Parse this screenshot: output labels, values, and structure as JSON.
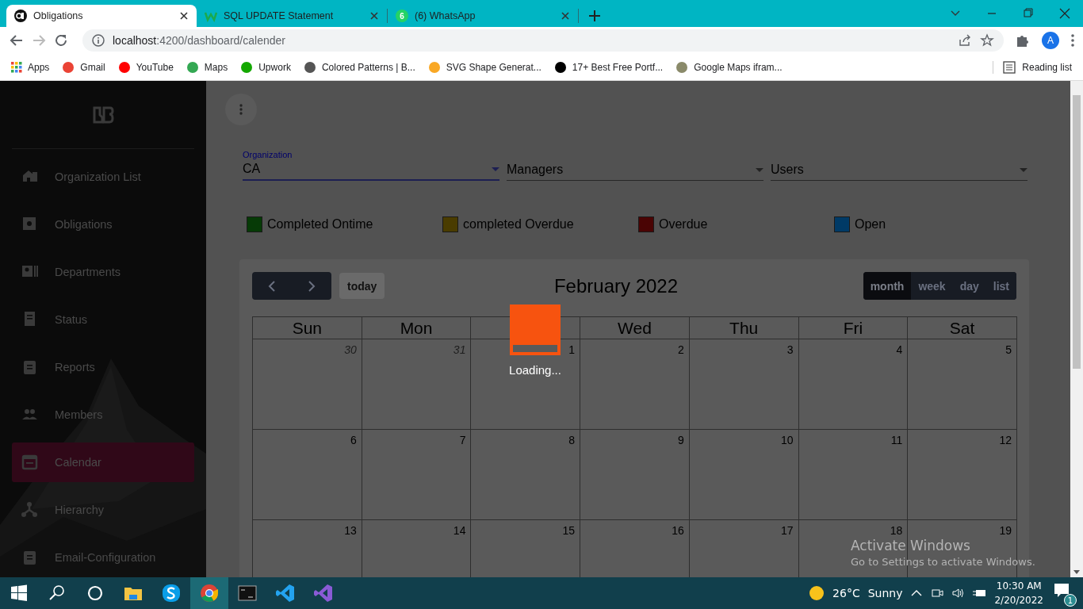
{
  "browser": {
    "tabs": [
      {
        "title": "Obligations",
        "selected": true
      },
      {
        "title": "SQL UPDATE Statement",
        "selected": false
      },
      {
        "title": "(6) WhatsApp",
        "selected": false,
        "badge": "6"
      }
    ],
    "url_host": "localhost",
    "url_path": ":4200/dashboard/calender",
    "profile": "A",
    "bookmarks": [
      "Apps",
      "Gmail",
      "YouTube",
      "Maps",
      "Upwork",
      "Colored Patterns | B...",
      "SVG Shape Generat...",
      "17+ Best Free Portf...",
      "Google Maps ifram..."
    ],
    "reading_list": "Reading list"
  },
  "sidebar": {
    "items": [
      {
        "label": "Organization List",
        "selected": false
      },
      {
        "label": "Obligations",
        "selected": false
      },
      {
        "label": "Departments",
        "selected": false
      },
      {
        "label": "Status",
        "selected": false
      },
      {
        "label": "Reports",
        "selected": false
      },
      {
        "label": "Members",
        "selected": false
      },
      {
        "label": "Calendar",
        "selected": true
      },
      {
        "label": "Hierarchy",
        "selected": false
      },
      {
        "label": "Email-Configuration",
        "selected": false
      }
    ]
  },
  "filters": [
    {
      "label": "Organization",
      "value": "CA",
      "focused": true
    },
    {
      "placeholder": "Managers",
      "focused": false
    },
    {
      "placeholder": "Users",
      "focused": false
    }
  ],
  "legend": [
    {
      "label": "Completed Ontime",
      "color": "#063a06"
    },
    {
      "label": "completed Overdue",
      "color": "#4a3c00"
    },
    {
      "label": "Overdue",
      "color": "#4a0404"
    },
    {
      "label": "Open",
      "color": "#003a66"
    }
  ],
  "calendar": {
    "title": "February 2022",
    "today": "today",
    "views": [
      {
        "label": "month",
        "selected": true
      },
      {
        "label": "week",
        "selected": false
      },
      {
        "label": "day",
        "selected": false
      },
      {
        "label": "list",
        "selected": false
      }
    ],
    "headers": [
      "Sun",
      "Mon",
      "Wed",
      "Thu",
      "Fri",
      "Sat"
    ],
    "weeks": [
      [
        {
          "day": "30",
          "other_month": true
        },
        {
          "day": "31",
          "other_month": true
        },
        {
          "day": "1",
          "other_month": false
        },
        {
          "day": "2",
          "other_month": false
        },
        {
          "day": "3",
          "other_month": false
        },
        {
          "day": "4",
          "other_month": false
        },
        {
          "day": "5",
          "other_month": false
        }
      ],
      [
        {
          "day": "6",
          "other_month": false
        },
        {
          "day": "7",
          "other_month": false
        },
        {
          "day": "8",
          "other_month": false
        },
        {
          "day": "9",
          "other_month": false
        },
        {
          "day": "10",
          "other_month": false
        },
        {
          "day": "11",
          "other_month": false
        },
        {
          "day": "12",
          "other_month": false
        }
      ],
      [
        {
          "day": "13",
          "other_month": false
        },
        {
          "day": "14",
          "other_month": false
        },
        {
          "day": "15",
          "other_month": false
        },
        {
          "day": "16",
          "other_month": false
        },
        {
          "day": "17",
          "other_month": false
        },
        {
          "day": "18",
          "other_month": false
        },
        {
          "day": "19",
          "other_month": false
        }
      ]
    ]
  },
  "loading": {
    "text": "Loading..."
  },
  "activation": {
    "title": "Activate Windows",
    "subtitle": "Go to Settings to activate Windows."
  },
  "taskbar": {
    "temperature": "26°C",
    "condition": "Sunny",
    "time": "10:30 AM",
    "date": "2/20/2022",
    "notifications": "1"
  }
}
